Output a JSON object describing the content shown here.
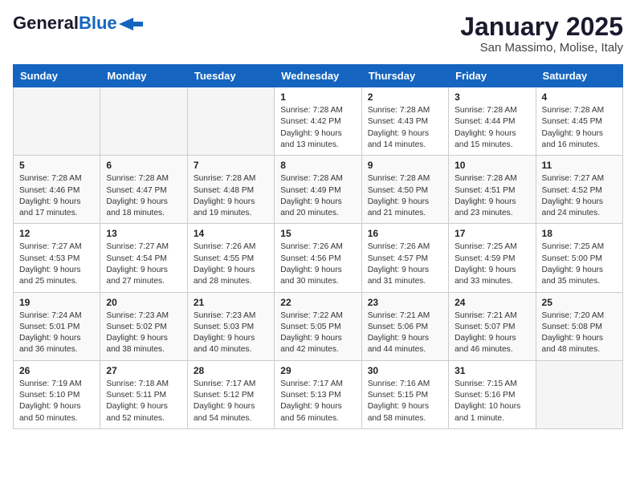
{
  "logo": {
    "general": "General",
    "blue": "Blue"
  },
  "title": "January 2025",
  "location": "San Massimo, Molise, Italy",
  "weekdays": [
    "Sunday",
    "Monday",
    "Tuesday",
    "Wednesday",
    "Thursday",
    "Friday",
    "Saturday"
  ],
  "weeks": [
    [
      {
        "day": "",
        "info": ""
      },
      {
        "day": "",
        "info": ""
      },
      {
        "day": "",
        "info": ""
      },
      {
        "day": "1",
        "info": "Sunrise: 7:28 AM\nSunset: 4:42 PM\nDaylight: 9 hours and 13 minutes."
      },
      {
        "day": "2",
        "info": "Sunrise: 7:28 AM\nSunset: 4:43 PM\nDaylight: 9 hours and 14 minutes."
      },
      {
        "day": "3",
        "info": "Sunrise: 7:28 AM\nSunset: 4:44 PM\nDaylight: 9 hours and 15 minutes."
      },
      {
        "day": "4",
        "info": "Sunrise: 7:28 AM\nSunset: 4:45 PM\nDaylight: 9 hours and 16 minutes."
      }
    ],
    [
      {
        "day": "5",
        "info": "Sunrise: 7:28 AM\nSunset: 4:46 PM\nDaylight: 9 hours and 17 minutes."
      },
      {
        "day": "6",
        "info": "Sunrise: 7:28 AM\nSunset: 4:47 PM\nDaylight: 9 hours and 18 minutes."
      },
      {
        "day": "7",
        "info": "Sunrise: 7:28 AM\nSunset: 4:48 PM\nDaylight: 9 hours and 19 minutes."
      },
      {
        "day": "8",
        "info": "Sunrise: 7:28 AM\nSunset: 4:49 PM\nDaylight: 9 hours and 20 minutes."
      },
      {
        "day": "9",
        "info": "Sunrise: 7:28 AM\nSunset: 4:50 PM\nDaylight: 9 hours and 21 minutes."
      },
      {
        "day": "10",
        "info": "Sunrise: 7:28 AM\nSunset: 4:51 PM\nDaylight: 9 hours and 23 minutes."
      },
      {
        "day": "11",
        "info": "Sunrise: 7:27 AM\nSunset: 4:52 PM\nDaylight: 9 hours and 24 minutes."
      }
    ],
    [
      {
        "day": "12",
        "info": "Sunrise: 7:27 AM\nSunset: 4:53 PM\nDaylight: 9 hours and 25 minutes."
      },
      {
        "day": "13",
        "info": "Sunrise: 7:27 AM\nSunset: 4:54 PM\nDaylight: 9 hours and 27 minutes."
      },
      {
        "day": "14",
        "info": "Sunrise: 7:26 AM\nSunset: 4:55 PM\nDaylight: 9 hours and 28 minutes."
      },
      {
        "day": "15",
        "info": "Sunrise: 7:26 AM\nSunset: 4:56 PM\nDaylight: 9 hours and 30 minutes."
      },
      {
        "day": "16",
        "info": "Sunrise: 7:26 AM\nSunset: 4:57 PM\nDaylight: 9 hours and 31 minutes."
      },
      {
        "day": "17",
        "info": "Sunrise: 7:25 AM\nSunset: 4:59 PM\nDaylight: 9 hours and 33 minutes."
      },
      {
        "day": "18",
        "info": "Sunrise: 7:25 AM\nSunset: 5:00 PM\nDaylight: 9 hours and 35 minutes."
      }
    ],
    [
      {
        "day": "19",
        "info": "Sunrise: 7:24 AM\nSunset: 5:01 PM\nDaylight: 9 hours and 36 minutes."
      },
      {
        "day": "20",
        "info": "Sunrise: 7:23 AM\nSunset: 5:02 PM\nDaylight: 9 hours and 38 minutes."
      },
      {
        "day": "21",
        "info": "Sunrise: 7:23 AM\nSunset: 5:03 PM\nDaylight: 9 hours and 40 minutes."
      },
      {
        "day": "22",
        "info": "Sunrise: 7:22 AM\nSunset: 5:05 PM\nDaylight: 9 hours and 42 minutes."
      },
      {
        "day": "23",
        "info": "Sunrise: 7:21 AM\nSunset: 5:06 PM\nDaylight: 9 hours and 44 minutes."
      },
      {
        "day": "24",
        "info": "Sunrise: 7:21 AM\nSunset: 5:07 PM\nDaylight: 9 hours and 46 minutes."
      },
      {
        "day": "25",
        "info": "Sunrise: 7:20 AM\nSunset: 5:08 PM\nDaylight: 9 hours and 48 minutes."
      }
    ],
    [
      {
        "day": "26",
        "info": "Sunrise: 7:19 AM\nSunset: 5:10 PM\nDaylight: 9 hours and 50 minutes."
      },
      {
        "day": "27",
        "info": "Sunrise: 7:18 AM\nSunset: 5:11 PM\nDaylight: 9 hours and 52 minutes."
      },
      {
        "day": "28",
        "info": "Sunrise: 7:17 AM\nSunset: 5:12 PM\nDaylight: 9 hours and 54 minutes."
      },
      {
        "day": "29",
        "info": "Sunrise: 7:17 AM\nSunset: 5:13 PM\nDaylight: 9 hours and 56 minutes."
      },
      {
        "day": "30",
        "info": "Sunrise: 7:16 AM\nSunset: 5:15 PM\nDaylight: 9 hours and 58 minutes."
      },
      {
        "day": "31",
        "info": "Sunrise: 7:15 AM\nSunset: 5:16 PM\nDaylight: 10 hours and 1 minute."
      },
      {
        "day": "",
        "info": ""
      }
    ]
  ]
}
